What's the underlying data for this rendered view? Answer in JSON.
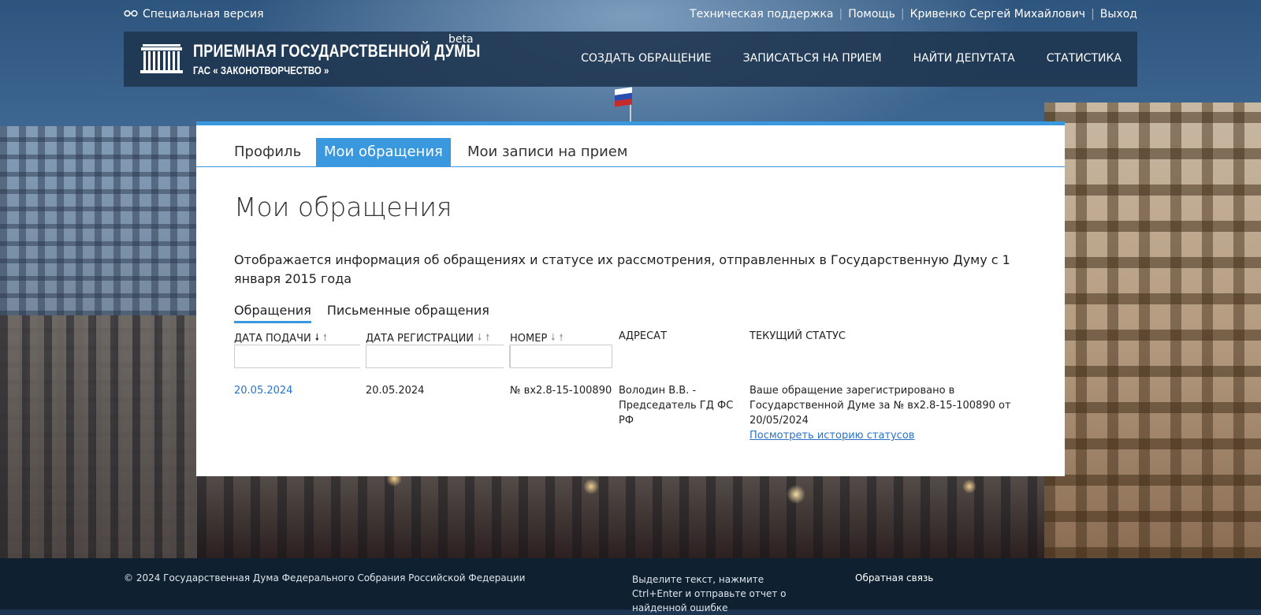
{
  "topbar": {
    "special_version": "Специальная версия",
    "links": [
      "Техническая поддержка",
      "Помощь",
      "Кривенко Сергей Михайлович",
      "Выход"
    ]
  },
  "header": {
    "title": "ПРИЕМНАЯ ГОСУДАРСТВЕННОЙ ДУМЫ",
    "subtitle": "ГАС « ЗАКОНОТВОРЧЕСТВО »",
    "beta": "beta",
    "nav": [
      "СОЗДАТЬ ОБРАЩЕНИЕ",
      "ЗАПИСАТЬСЯ НА ПРИЕМ",
      "НАЙТИ ДЕПУТАТА",
      "СТАТИСТИКА"
    ]
  },
  "tabs": [
    "Профиль",
    "Мои обращения",
    "Мои записи на прием"
  ],
  "active_tab": "Мои обращения",
  "page_title": "Мои обращения",
  "intro": "Отображается информация об обращениях и статусе их рассмотрения, отправленных в Государственную Думу с 1 января 2015 года",
  "subtabs": [
    "Обращения",
    "Письменные обращения"
  ],
  "table": {
    "columns": [
      "ДАТА ПОДАЧИ",
      "ДАТА РЕГИСТРАЦИИ",
      "НОМЕР",
      "АДРЕСАТ",
      "ТЕКУЩИЙ СТАТУС"
    ],
    "sort_down": "🠗",
    "sort_up": "🠕",
    "rows": [
      {
        "submitted": "20.05.2024",
        "registered": "20.05.2024",
        "number": "№ вх2.8-15-100890",
        "addressee": "Володин В.В. - Председатель ГД ФС РФ",
        "status": "Ваше обращение зарегистрировано в Государственной Думе за № вх2.8-15-100890 от 20/05/2024",
        "history_link": "Посмотреть историю статусов"
      }
    ]
  },
  "footer": {
    "copyright": "© 2024 Государственная Дума Федерального Собрания Российской Федерации",
    "report": "Выделите текст, нажмите Ctrl+Enter и отправьте отчет о найденной ошибке",
    "feedback": "Обратная связь"
  },
  "colors": {
    "accent": "#3a98de",
    "header_bg": "#1e344e",
    "footer_bg": "#0f2130",
    "link": "#2a72c7"
  }
}
